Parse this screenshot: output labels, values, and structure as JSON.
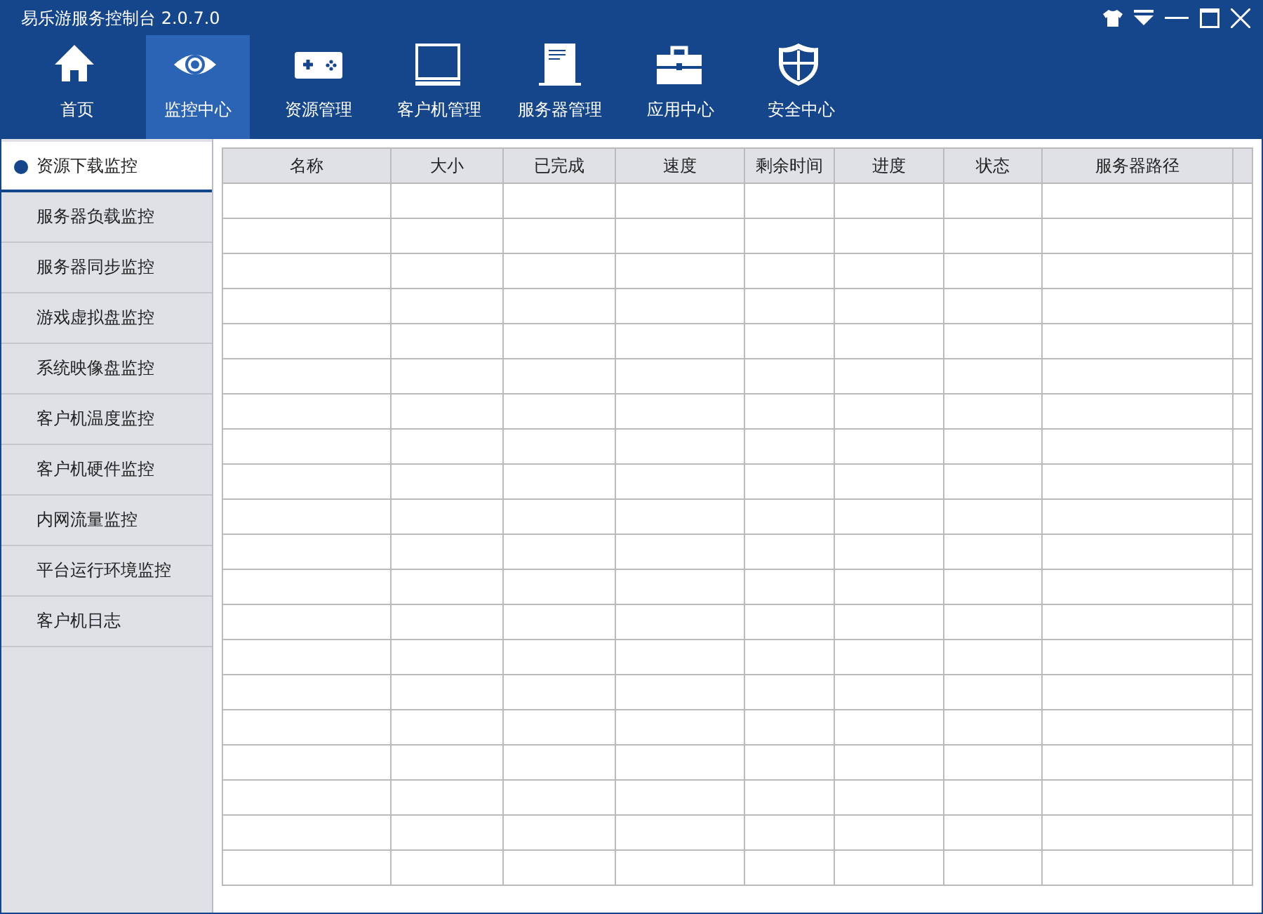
{
  "window": {
    "title": "易乐游服务控制台 2.0.7.0"
  },
  "toolbar": [
    {
      "label": "首页",
      "selected": false
    },
    {
      "label": "监控中心",
      "selected": true
    },
    {
      "label": "资源管理",
      "selected": false
    },
    {
      "label": "客户机管理",
      "selected": false
    },
    {
      "label": "服务器管理",
      "selected": false
    },
    {
      "label": "应用中心",
      "selected": false
    },
    {
      "label": "安全中心",
      "selected": false
    }
  ],
  "sidebar": {
    "items": [
      {
        "label": "资源下载监控",
        "selected": true
      },
      {
        "label": "服务器负载监控",
        "selected": false
      },
      {
        "label": "服务器同步监控",
        "selected": false
      },
      {
        "label": "游戏虚拟盘监控",
        "selected": false
      },
      {
        "label": "系统映像盘监控",
        "selected": false
      },
      {
        "label": "客户机温度监控",
        "selected": false
      },
      {
        "label": "客户机硬件监控",
        "selected": false
      },
      {
        "label": "内网流量监控",
        "selected": false
      },
      {
        "label": "平台运行环境监控",
        "selected": false
      },
      {
        "label": "客户机日志",
        "selected": false
      }
    ]
  },
  "table": {
    "columns": [
      "名称",
      "大小",
      "已完成",
      "速度",
      "剩余时间",
      "进度",
      "状态",
      "服务器路径"
    ]
  }
}
